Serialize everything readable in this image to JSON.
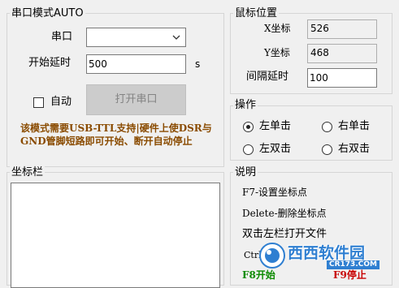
{
  "serial_group": {
    "title": "串口模式AUTO",
    "port_label": "串口",
    "port_value": "",
    "delay_label": "开始延时",
    "delay_value": "500",
    "delay_unit": "s",
    "auto_label": "自动",
    "open_button": "打开串口",
    "note": "该模式需要USB-TTL支持|硬件上使DSR与GND管脚短路即可开始、断开自动停止"
  },
  "mouse_group": {
    "title": "鼠标位置",
    "x_label": "X坐标",
    "x_value": "526",
    "y_label": "Y坐标",
    "y_value": "468",
    "interval_label": "间隔延时",
    "interval_value": "100"
  },
  "op_group": {
    "title": "操作",
    "options": [
      "左单击",
      "右单击",
      "左双击",
      "右双击"
    ],
    "selected": "左单击"
  },
  "coord_group": {
    "title": "坐标栏"
  },
  "help_group": {
    "title": "说明",
    "line1": "F7-设置坐标点",
    "line2": "Delete-删除坐标点",
    "line3": "双击左栏打开文件",
    "line4_prefix": "Ctrl",
    "f8": "F8开始",
    "f9": "F9停止"
  },
  "watermark": {
    "brand": "西西软件园",
    "domain": "CR173.COM"
  },
  "colors": {
    "note": "#8a4b00",
    "f8": "#0b8a00",
    "f9": "#c80000",
    "watermark": "#2f7fd1"
  }
}
